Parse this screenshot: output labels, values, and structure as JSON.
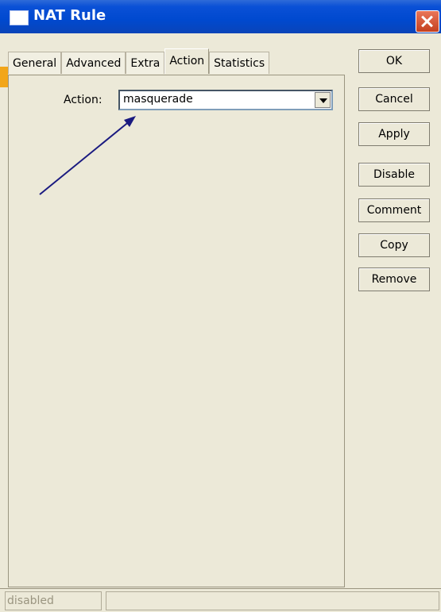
{
  "window": {
    "title": "NAT Rule"
  },
  "tabs": [
    {
      "label": "General"
    },
    {
      "label": "Advanced"
    },
    {
      "label": "Extra"
    },
    {
      "label": "Action"
    },
    {
      "label": "Statistics"
    }
  ],
  "active_tab": "Action",
  "form": {
    "action_label": "Action:",
    "action_value": "masquerade"
  },
  "buttons": {
    "ok": "OK",
    "cancel": "Cancel",
    "apply": "Apply",
    "disable": "Disable",
    "comment": "Comment",
    "copy": "Copy",
    "remove": "Remove"
  },
  "status": {
    "text": "disabled"
  },
  "colors": {
    "titlebar": "#0049cf",
    "window_bg": "#ece9d8",
    "annotation_arrow": "#1a1a80",
    "close_button": "#d5512f"
  },
  "icons": {
    "title": "window-icon",
    "close": "close-icon",
    "dropdown": "chevron-down-icon",
    "annotation": "arrow-annotation"
  }
}
